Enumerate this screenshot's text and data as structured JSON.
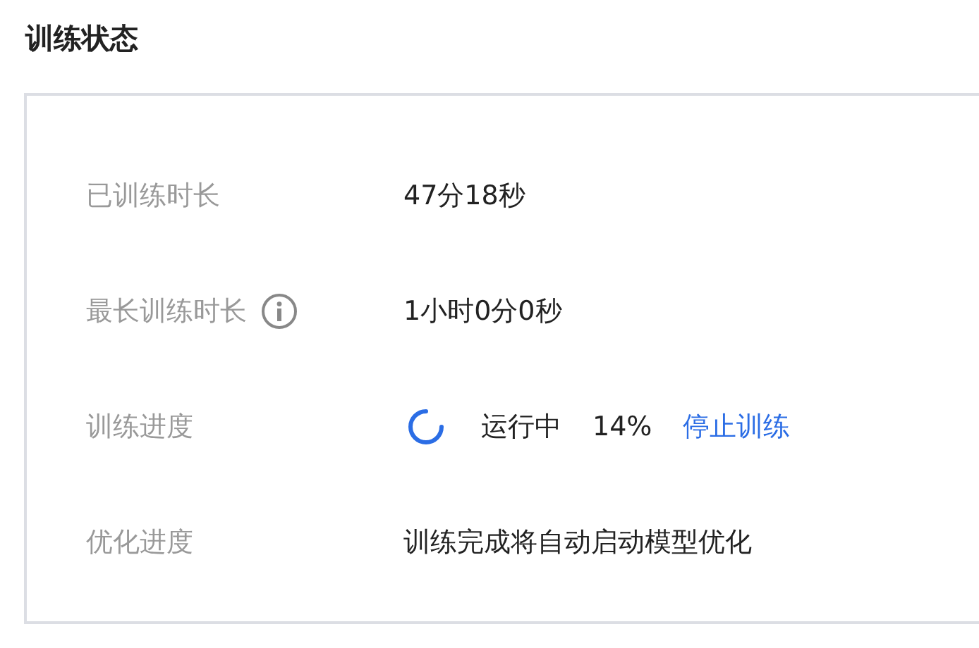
{
  "title": "训练状态",
  "rows": [
    {
      "kind": "text",
      "label": "已训练时长",
      "value": "47分18秒",
      "info": false
    },
    {
      "kind": "text",
      "label": "最长训练时长",
      "value": "1小时0分0秒",
      "info": true
    },
    {
      "kind": "progress",
      "label": "训练进度",
      "status": "运行中",
      "percent": "14%",
      "action": "停止训练",
      "info": false
    },
    {
      "kind": "text",
      "label": "优化进度",
      "value": "训练完成将自动启动模型优化",
      "info": false
    }
  ]
}
